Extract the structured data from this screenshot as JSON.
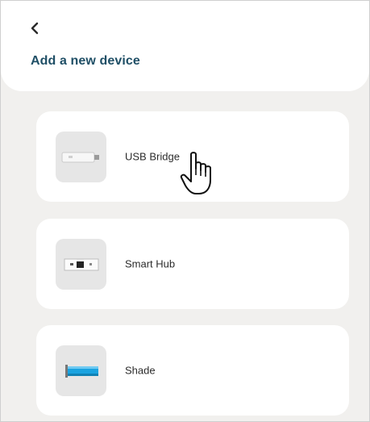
{
  "header": {
    "back_icon": "chevron-left-icon",
    "title": "Add a new device"
  },
  "devices": [
    {
      "label": "USB Bridge",
      "icon": "usb-bridge-icon"
    },
    {
      "label": "Smart Hub",
      "icon": "smart-hub-icon"
    },
    {
      "label": "Shade",
      "icon": "shade-icon"
    }
  ],
  "cursor": {
    "icon": "hand-pointer-icon"
  },
  "colors": {
    "title": "#1f4f66",
    "background": "#f1f0ee",
    "card": "#ffffff",
    "thumb": "#e6e6e6",
    "shade_accent": "#1aa3e0"
  }
}
